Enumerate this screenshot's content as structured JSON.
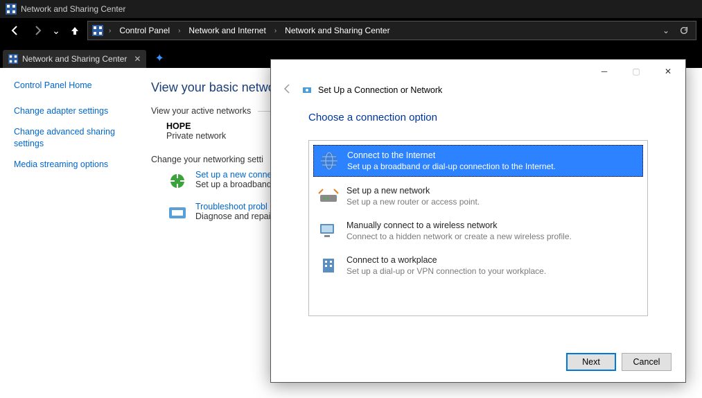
{
  "titlebar": {
    "text": "Network and Sharing Center"
  },
  "breadcrumbs": [
    "Control Panel",
    "Network and Internet",
    "Network and Sharing Center"
  ],
  "tab": {
    "label": "Network and Sharing Center"
  },
  "sidebar": {
    "home": "Control Panel Home",
    "links": [
      "Change adapter settings",
      "Change advanced sharing settings",
      "Media streaming options"
    ]
  },
  "main": {
    "heading": "View your basic netwo",
    "sec1": "View your active networks",
    "network": {
      "name": "HOPE",
      "type": "Private network"
    },
    "sec2": "Change your networking setti",
    "actions": [
      {
        "title": "Set up a new conne",
        "desc": "Set up a broadband"
      },
      {
        "title": "Troubleshoot probl",
        "desc": "Diagnose and repai"
      }
    ]
  },
  "dialog": {
    "header": "Set Up a Connection or Network",
    "h": "Choose a connection option",
    "options": [
      {
        "title": "Connect to the Internet",
        "desc": "Set up a broadband or dial-up connection to the Internet."
      },
      {
        "title": "Set up a new network",
        "desc": "Set up a new router or access point."
      },
      {
        "title": "Manually connect to a wireless network",
        "desc": "Connect to a hidden network or create a new wireless profile."
      },
      {
        "title": "Connect to a workplace",
        "desc": "Set up a dial-up or VPN connection to your workplace."
      }
    ],
    "next": "Next",
    "cancel": "Cancel"
  }
}
